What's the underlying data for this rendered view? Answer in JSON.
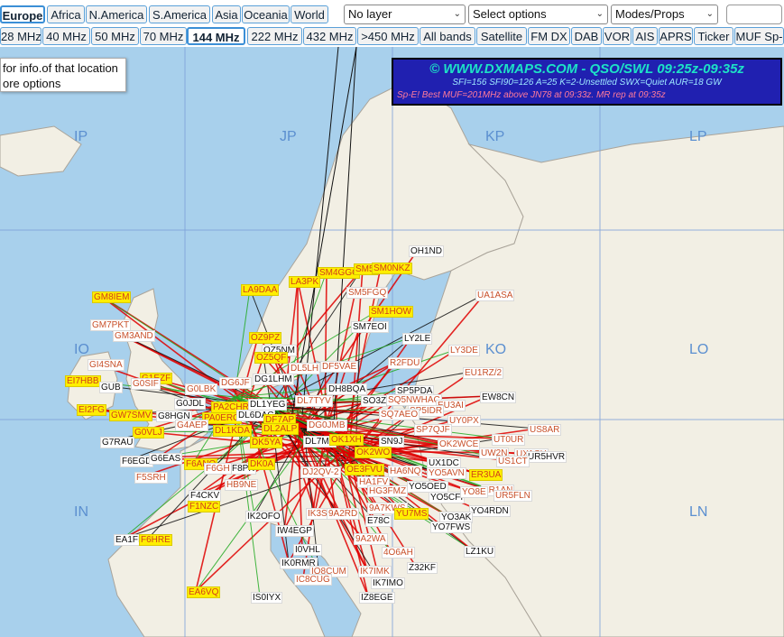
{
  "regions": [
    "Europe",
    "Africa",
    "N.America",
    "S.America",
    "Asia",
    "Oceania",
    "World"
  ],
  "active_region": "Europe",
  "dropdowns": {
    "layer": "No layer",
    "options": "Select options",
    "modes": "Modes/Props"
  },
  "bands": [
    "28 MHz",
    "40 MHz",
    "50 MHz",
    "70 MHz",
    "144 MHz",
    "222 MHz",
    "432 MHz",
    ">450 MHz",
    "All bands",
    "Satellite",
    "FM DX",
    "DAB",
    "VOR",
    "AIS",
    "APRS",
    "Ticker",
    "MUF Sp-"
  ],
  "active_band": "144 MHz",
  "info_popup": {
    "line1": " for info.of that location",
    "line2": "ore options"
  },
  "banner": {
    "title": "© WWW.DXMAPS.COM - QSO/SWL 09:25z-09:35z",
    "indices": "SFI=156 SFI90=126 A=25 K=2-Unsettled SWX=Quiet AUR=18 GW",
    "alert": "Sp-E! Best MUF=201MHz above JN78 at 09:33z. MR rep at 09:35z"
  },
  "grid_squares": [
    "IP",
    "JP",
    "KP",
    "LP",
    "IO",
    "KO",
    "LO",
    "IN",
    "LN"
  ],
  "callsigns": [
    {
      "t": "OH1ND",
      "s": "w"
    },
    {
      "t": "SM4GGC",
      "s": "y"
    },
    {
      "t": "SM5I",
      "s": "y"
    },
    {
      "t": "SM0NKZ",
      "s": "y"
    },
    {
      "t": "LA9DAA",
      "s": "y"
    },
    {
      "t": "LA3PK",
      "s": "y"
    },
    {
      "t": "SM5FGQ",
      "s": "o"
    },
    {
      "t": "UA1ASA",
      "s": "o"
    },
    {
      "t": "GM8IEM",
      "s": "y"
    },
    {
      "t": "SM1HOW",
      "s": "y"
    },
    {
      "t": "GM7PKT",
      "s": "o"
    },
    {
      "t": "SM7EOI",
      "s": "w"
    },
    {
      "t": "GM3AND",
      "s": "o"
    },
    {
      "t": "OZ9PZ",
      "s": "y"
    },
    {
      "t": "LY2LE",
      "s": "w"
    },
    {
      "t": "OZ5NM",
      "s": "w"
    },
    {
      "t": "LY3DE",
      "s": "o"
    },
    {
      "t": "OZ5QF",
      "s": "y"
    },
    {
      "t": "GI4SNA",
      "s": "o"
    },
    {
      "t": "DF5VAE",
      "s": "o"
    },
    {
      "t": "R2FDU",
      "s": "o"
    },
    {
      "t": "DL5LH",
      "s": "o"
    },
    {
      "t": "EU1RZ/2",
      "s": "o"
    },
    {
      "t": "G1EZF",
      "s": "y"
    },
    {
      "t": "EI7HBB",
      "s": "y"
    },
    {
      "t": "DG1LHM",
      "s": "w"
    },
    {
      "t": "G0SIF",
      "s": "o"
    },
    {
      "t": "GUB",
      "s": "w"
    },
    {
      "t": "DG6JF",
      "s": "o"
    },
    {
      "t": "DH8BQA",
      "s": "w"
    },
    {
      "t": "G0LBK",
      "s": "o"
    },
    {
      "t": "SP5PDA",
      "s": "w"
    },
    {
      "t": "EW8CN",
      "s": "w"
    },
    {
      "t": "DL7TYV",
      "s": "o"
    },
    {
      "t": "SO3Z",
      "s": "w"
    },
    {
      "t": "SQ5NWHAC",
      "s": "o"
    },
    {
      "t": "G0JDL",
      "s": "w"
    },
    {
      "t": "PA2CHR",
      "s": "y"
    },
    {
      "t": "DL1YEG",
      "s": "w"
    },
    {
      "t": "EU3AI",
      "s": "o"
    },
    {
      "t": "EI2FG",
      "s": "y"
    },
    {
      "t": "SP5IDR",
      "s": "o"
    },
    {
      "t": "GW7SMV",
      "s": "y"
    },
    {
      "t": "G8HGN",
      "s": "w"
    },
    {
      "t": "PA0ERG",
      "s": "y"
    },
    {
      "t": "DL6DAC",
      "s": "w"
    },
    {
      "t": "DF7AP",
      "s": "y"
    },
    {
      "t": "SQ7AEO",
      "s": "o"
    },
    {
      "t": "UY0PX",
      "s": "o"
    },
    {
      "t": "G4AEP",
      "s": "o"
    },
    {
      "t": "DG0JMB",
      "s": "o"
    },
    {
      "t": "SP7QJF",
      "s": "o"
    },
    {
      "t": "US8AR",
      "s": "o"
    },
    {
      "t": "G0VLJ",
      "s": "y"
    },
    {
      "t": "DL1KDA",
      "s": "y"
    },
    {
      "t": "DL2ALP",
      "s": "y"
    },
    {
      "t": "UT0UR",
      "s": "o"
    },
    {
      "t": "G7RAU",
      "s": "w"
    },
    {
      "t": "DK5YA",
      "s": "y"
    },
    {
      "t": "DL7MF",
      "s": "w"
    },
    {
      "t": "OK1XH",
      "s": "y"
    },
    {
      "t": "SN9J",
      "s": "w"
    },
    {
      "t": "OK2WCE",
      "s": "o"
    },
    {
      "t": "UX1CH",
      "s": "o"
    },
    {
      "t": "OK2WO",
      "s": "y"
    },
    {
      "t": "UW2N",
      "s": "o"
    },
    {
      "t": "UR5HVR",
      "s": "w"
    },
    {
      "t": "F6EGD",
      "s": "w"
    },
    {
      "t": "G6EAS",
      "s": "w"
    },
    {
      "t": "F6ANO",
      "s": "y"
    },
    {
      "t": "F8PK",
      "s": "w"
    },
    {
      "t": "DK0A",
      "s": "y"
    },
    {
      "t": "OE3FVU",
      "s": "y"
    },
    {
      "t": "UX1DC",
      "s": "w"
    },
    {
      "t": "US1CT",
      "s": "o"
    },
    {
      "t": "F5SRH",
      "s": "o"
    },
    {
      "t": "F6GH",
      "s": "o"
    },
    {
      "t": "DJ2QV-2",
      "s": "o"
    },
    {
      "t": "HA6NQ",
      "s": "o"
    },
    {
      "t": "YO5AVN",
      "s": "o"
    },
    {
      "t": "ER3UA",
      "s": "y"
    },
    {
      "t": "HB9NE",
      "s": "o"
    },
    {
      "t": "HA1FV",
      "s": "o"
    },
    {
      "t": "YO5OED",
      "s": "w"
    },
    {
      "t": "ER1AN",
      "s": "o"
    },
    {
      "t": "F4CKV",
      "s": "w"
    },
    {
      "t": "HG3FMZ",
      "s": "o"
    },
    {
      "t": "YO5CFI",
      "s": "w"
    },
    {
      "t": "YO8E",
      "s": "o"
    },
    {
      "t": "UR5FLN",
      "s": "o"
    },
    {
      "t": "F1NZC",
      "s": "y"
    },
    {
      "t": "9A7KWS",
      "s": "o"
    },
    {
      "t": "YU7MS",
      "s": "y"
    },
    {
      "t": "YO4RDN",
      "s": "w"
    },
    {
      "t": "IK2OFO",
      "s": "w"
    },
    {
      "t": "IK3S",
      "s": "o"
    },
    {
      "t": "9A2RD",
      "s": "o"
    },
    {
      "t": "E78C",
      "s": "w"
    },
    {
      "t": "YO3AK",
      "s": "w"
    },
    {
      "t": "YO7FWS",
      "s": "w"
    },
    {
      "t": "IW4EGP",
      "s": "w"
    },
    {
      "t": "EA1FI",
      "s": "w"
    },
    {
      "t": "F6HRE",
      "s": "y"
    },
    {
      "t": "9A2WA",
      "s": "o"
    },
    {
      "t": "LZ1KU",
      "s": "w"
    },
    {
      "t": "I0VHL",
      "s": "w"
    },
    {
      "t": "4O6AH",
      "s": "o"
    },
    {
      "t": "IK0RMR",
      "s": "w"
    },
    {
      "t": "Z32KF",
      "s": "w"
    },
    {
      "t": "IQ8CUM",
      "s": "o"
    },
    {
      "t": "IK7IMK",
      "s": "o"
    },
    {
      "t": "IC8CUG",
      "s": "o"
    },
    {
      "t": "IK7IMO",
      "s": "w"
    },
    {
      "t": "EA6VQ",
      "s": "y"
    },
    {
      "t": "IS0IYX",
      "s": "w"
    },
    {
      "t": "IZ8EGE",
      "s": "w"
    }
  ],
  "colors": {
    "sea": "#a8d0ec",
    "land": "#f2efe4",
    "border": "#aaa49a",
    "grid": "#7a9fd8",
    "path_main": "#e00000",
    "path_alt": "#22aa22",
    "path_black": "#111111",
    "banner_bg": "#2020b0"
  }
}
